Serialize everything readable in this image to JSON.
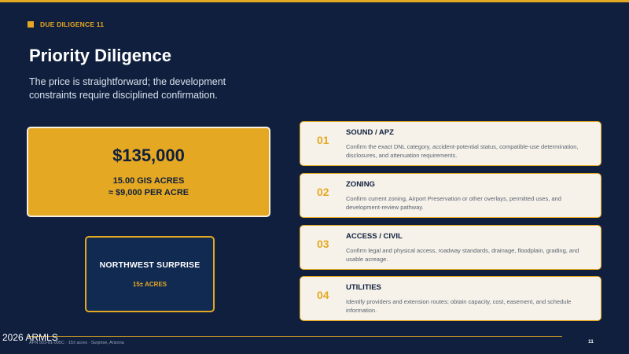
{
  "header": {
    "eyebrow": "DUE DILIGENCE 11",
    "title": "Priority Diligence",
    "subtitle": "The price is straightforward; the development constraints require disciplined confirmation."
  },
  "price_card": {
    "price": "$135,000",
    "acres": "15.00 GIS ACRES",
    "per_acre": "≈ $9,000 PER ACRE"
  },
  "location_card": {
    "title": "NORTHWEST SURPRISE",
    "subtitle": "15± ACRES"
  },
  "items": [
    {
      "number": "01",
      "title": "SOUND / APZ",
      "description": "Confirm the exact DNL category, accident-potential status, compatible-use determination, disclosures, and attenuation requirements."
    },
    {
      "number": "02",
      "title": "ZONING",
      "description": "Confirm current zoning, Airport Preservation or other overlays, permitted uses, and development-review pathway."
    },
    {
      "number": "03",
      "title": "ACCESS / CIVIL",
      "description": "Confirm legal and physical access, roadway standards, drainage, floodplain, grading, and usable acreage."
    },
    {
      "number": "04",
      "title": "UTILITIES",
      "description": "Identify providers and extension routes; obtain capacity, cost, easement, and schedule information."
    }
  ],
  "footer": {
    "watermark": "2026 ARMLS",
    "text": "APN 503-81-005C · 15± acres · Surprise, Arizona",
    "page_number": "11"
  },
  "colors": {
    "background": "#0f1f3d",
    "accent": "#e5a823",
    "card_light": "#f6f2e9"
  }
}
